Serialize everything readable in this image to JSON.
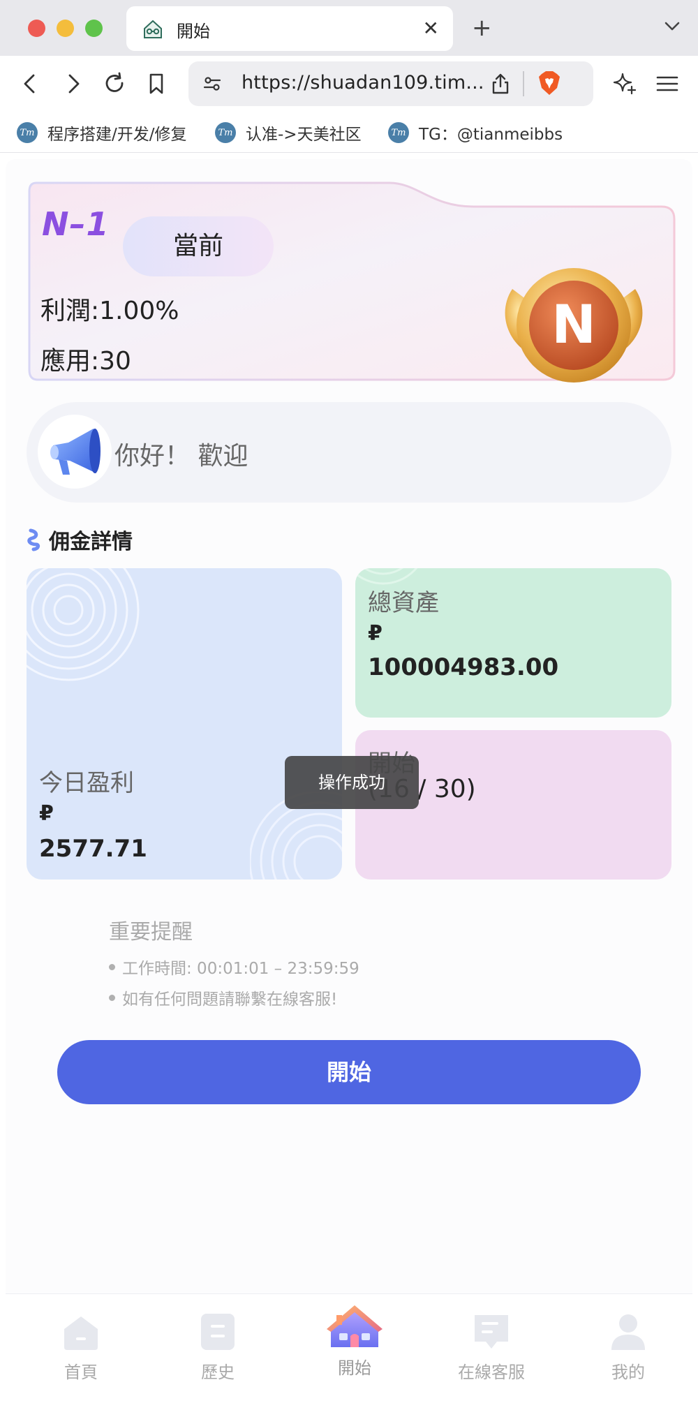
{
  "browser": {
    "tab_title": "開始",
    "url": "https://shuadan109.tim...",
    "bookmarks": [
      "程序搭建/开发/修复",
      "认准->天美社区",
      "TG：@tianmeibbs"
    ],
    "bookmark_icon_text": "Tm"
  },
  "level_card": {
    "name": "N–1",
    "current_label": "當前",
    "profit": "利潤:1.00%",
    "apps": "應用:30",
    "badge_letter": "N"
  },
  "notice": {
    "text": "你好！ 歡迎"
  },
  "commission": {
    "title": "佣金詳情",
    "today_label": "今日盈利",
    "today_currency": "₽",
    "today_value": "2577.71",
    "total_label": "總資產",
    "total_currency": "₽",
    "total_value": "100004983.00",
    "start_label": "開始",
    "start_progress": "(16 / 30)"
  },
  "toast": {
    "text": "操作成功"
  },
  "reminder": {
    "title": "重要提醒",
    "items": [
      "工作時間: 00:01:01 – 23:59:59",
      "如有任何問題請聯繫在線客服!"
    ]
  },
  "start_button": {
    "label": "開始"
  },
  "bottom_nav": {
    "items": [
      {
        "label": "首頁",
        "icon": "home-icon"
      },
      {
        "label": "歷史",
        "icon": "history-icon"
      },
      {
        "label": "開始",
        "icon": "house-colored-icon"
      },
      {
        "label": "在線客服",
        "icon": "chat-icon"
      },
      {
        "label": "我的",
        "icon": "user-icon"
      }
    ]
  },
  "colors": {
    "accent": "#4f66e2",
    "level_name": "#8b4fe0",
    "today_card": "#dbe6fa",
    "total_card": "#cdeedd",
    "start_card": "#f1dbf1"
  }
}
